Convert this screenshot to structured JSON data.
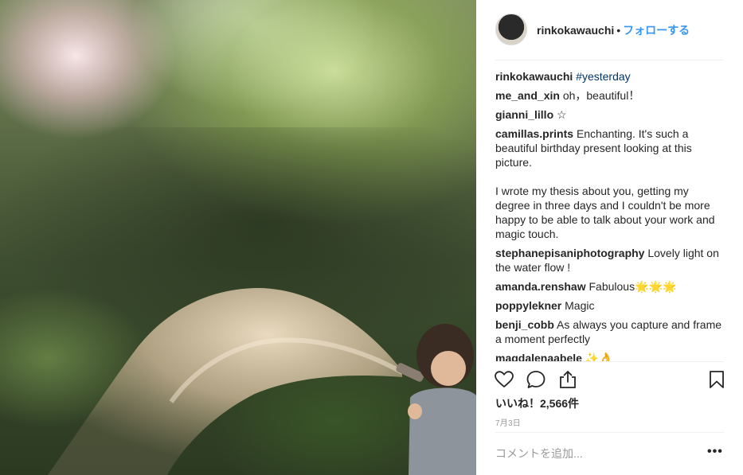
{
  "post": {
    "image_icon": "photo-child-watering-garden",
    "author": "rinkokawauchi",
    "separator": "•",
    "follow_label": "フォローする"
  },
  "comments": [
    {
      "user": "rinkokawauchi",
      "text": "",
      "hashtag": "#yesterday"
    },
    {
      "user": "me_and_xin",
      "text": "oh，beautiful！"
    },
    {
      "user": "gianni_lillo",
      "text": "☆"
    },
    {
      "user": "camillas.prints",
      "text": "Enchanting. It's such a beautiful birthday present looking at this picture.\n\nI wrote my thesis about you, getting my degree in three days and I couldn't be more happy to be able to talk about your work and magic touch."
    },
    {
      "user": "stephanepisaniphotography",
      "text": "Lovely light on the water flow !"
    },
    {
      "user": "amanda.renshaw",
      "text": "Fabulous🌟🌟🌟"
    },
    {
      "user": "poppylekner",
      "text": "Magic"
    },
    {
      "user": "benji_cobb",
      "text": "As always you capture and frame a moment perfectly"
    },
    {
      "user": "magdalenaabele",
      "text": "✨👌"
    }
  ],
  "actions": {
    "like_icon": "heart-icon",
    "comment_icon": "comment-bubble-icon",
    "share_icon": "share-icon",
    "save_icon": "bookmark-icon"
  },
  "likes_text": "いいね！2,566件",
  "date_text": "7月3日",
  "comment_box": {
    "placeholder": "コメントを追加...",
    "more_label": "•••"
  },
  "colors": {
    "link_blue": "#3897f0",
    "hashtag": "#003569",
    "text": "#262626",
    "muted": "#999999",
    "divider": "#efefef"
  }
}
